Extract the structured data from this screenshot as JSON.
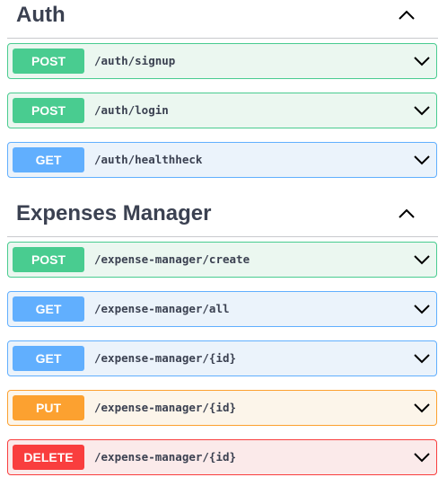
{
  "sections": [
    {
      "title": "Auth",
      "operations": [
        {
          "method": "POST",
          "path": "/auth/signup"
        },
        {
          "method": "POST",
          "path": "/auth/login"
        },
        {
          "method": "GET",
          "path": "/auth/healthheck"
        }
      ]
    },
    {
      "title": "Expenses Manager",
      "operations": [
        {
          "method": "POST",
          "path": "/expense-manager/create"
        },
        {
          "method": "GET",
          "path": "/expense-manager/all"
        },
        {
          "method": "GET",
          "path": "/expense-manager/{id}"
        },
        {
          "method": "PUT",
          "path": "/expense-manager/{id}"
        },
        {
          "method": "DELETE",
          "path": "/expense-manager/{id}"
        }
      ]
    }
  ],
  "colors": {
    "post": "#49cc90",
    "get": "#61affe",
    "put": "#fca130",
    "delete": "#f93e3e",
    "title_text": "#3b4151"
  },
  "icons": {
    "section_toggle": "chevron-up-icon",
    "operation_toggle": "chevron-down-icon"
  }
}
